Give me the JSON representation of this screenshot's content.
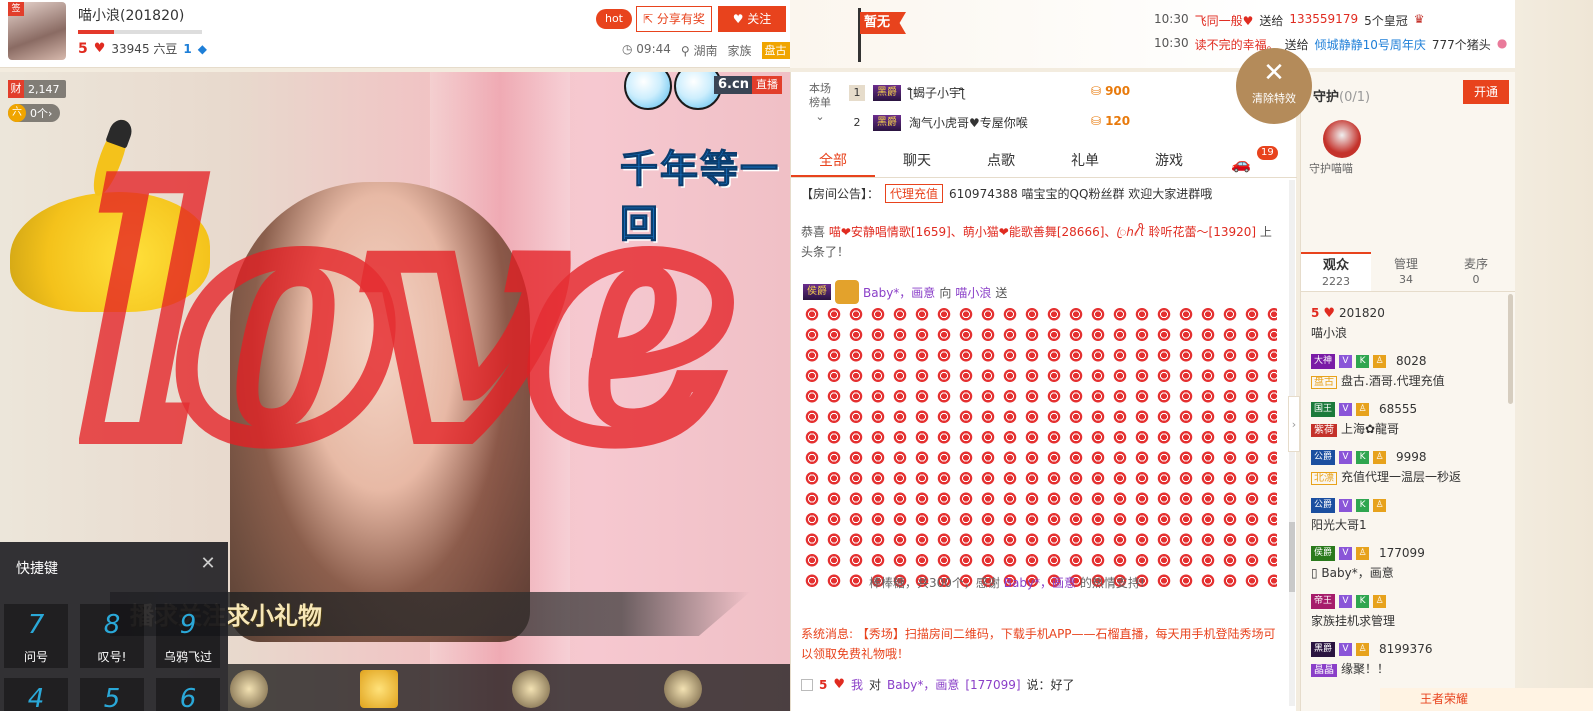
{
  "header": {
    "host_name": "喵小浪(201820)",
    "host_level": "5",
    "beans": "33945 六豆",
    "diamond_level": "1",
    "hot_label": "hot",
    "share_label": "分享有奖",
    "follow_label": "关注",
    "time": "09:44",
    "location": "湖南",
    "family_label": "家族",
    "family_name": "盘古"
  },
  "video": {
    "rich_count": "2,147",
    "rich_icon_label": "财",
    "beans_count": "0个",
    "beans_icon_label": "六",
    "site_suffix": "6.cn",
    "live_label": "直播",
    "song_title": "千年等一回",
    "marquee_text": "播求关注求小礼物",
    "overlay_word": "love",
    "progress": 0.29
  },
  "shortcut": {
    "title": "快捷键",
    "keys": [
      {
        "num": "7",
        "label": "问号"
      },
      {
        "num": "8",
        "label": "叹号!"
      },
      {
        "num": "9",
        "label": "乌鸦飞过"
      }
    ],
    "row2": [
      "4",
      "5",
      "6"
    ]
  },
  "top_notice": {
    "flag_label": "暂无",
    "items": [
      {
        "time": "10:30",
        "user": "飞同一般♥",
        "action": "送给",
        "target": "133559179",
        "gift": "5个皇冠"
      },
      {
        "time": "10:30",
        "user": "读不完的幸福。",
        "action": "送给",
        "target": "倾城静静10号周年庆",
        "gift": "777个猪头"
      }
    ]
  },
  "rank": {
    "label_line1": "本场",
    "label_line2": "榜单",
    "rows": [
      {
        "no": "1",
        "medal": "黑爵",
        "name": "ƪ蝎子小宇ƪ",
        "coins": "900"
      },
      {
        "no": "2",
        "medal": "黑爵",
        "name": "淘气小虎哥♥专屋你喉",
        "coins": "120"
      }
    ]
  },
  "close_effect_label": "清除特效",
  "chat": {
    "tabs": [
      "全部",
      "聊天",
      "点歌",
      "礼单",
      "游戏"
    ],
    "car_badge": "19",
    "announce_prefix": "【房间公告】：",
    "announce_tag": "代理充值",
    "announce_text": "610974388 喵宝宝的QQ粉丝群 欢迎大家进群哦",
    "congrats_prefix": "恭喜",
    "congrats_names": "喵❤安静唱情歌[1659]、萌小猫❤能歌善舞[28666]、ꦿℎ𝓁ꪻ 聆听花蕾～[13920]",
    "congrats_suffix": "上头条了！",
    "gift_sender": "Baby*，画意",
    "gift_to": "向",
    "gift_receiver": "喵小浪",
    "gift_send": "送",
    "candy_note_prefix": "棒棒糖，共300个，感谢",
    "candy_note_user": "Baby*，画意",
    "candy_note_suffix": "的热情支持!",
    "system_msg": "系统消息: 【秀场】扫描房间二维码，下载手机APP——石榴直播，每天用手机登陆秀场可以领取免费礼物哦！",
    "last_level": "5",
    "last_me": "我",
    "last_to": "对",
    "last_user": "Baby*，画意",
    "last_id": "[177099]",
    "last_said": "说：好了"
  },
  "guard": {
    "title": "守护",
    "count": "(0/1)",
    "open_label": "开通",
    "guard_label": "守护喵喵"
  },
  "audience": {
    "tabs": [
      {
        "label": "观众",
        "count": "2223"
      },
      {
        "label": "管理",
        "count": "34"
      },
      {
        "label": "麦序",
        "count": "0"
      }
    ],
    "items": [
      {
        "level": "5",
        "medal": "",
        "id": "201820",
        "fam": "",
        "name": "喵小浪"
      },
      {
        "level": "",
        "medal": "大神",
        "id": "8028",
        "fam": "盘古",
        "name": "盘古.酒哥.代理充值"
      },
      {
        "level": "",
        "medal": "国王",
        "id": "68555",
        "fam": "紫荷",
        "name": "上海✿龍哥"
      },
      {
        "level": "",
        "medal": "公爵",
        "id": "9998",
        "fam": "北漂",
        "name": "充值代理一温层一秒返"
      },
      {
        "level": "",
        "medal": "公爵",
        "id": "",
        "fam": "",
        "name": "阳光大哥1"
      },
      {
        "level": "",
        "medal": "侯爵",
        "id": "177099",
        "fam": "",
        "name": "Baby*，画意"
      },
      {
        "level": "",
        "medal": "帝王",
        "id": "",
        "fam": "",
        "name": "家族挂机求管理"
      },
      {
        "level": "",
        "medal": "黑爵",
        "id": "8199376",
        "fam": "晶晶",
        "name": "缘聚！！"
      }
    ]
  },
  "bottom_promo": "王者荣耀"
}
